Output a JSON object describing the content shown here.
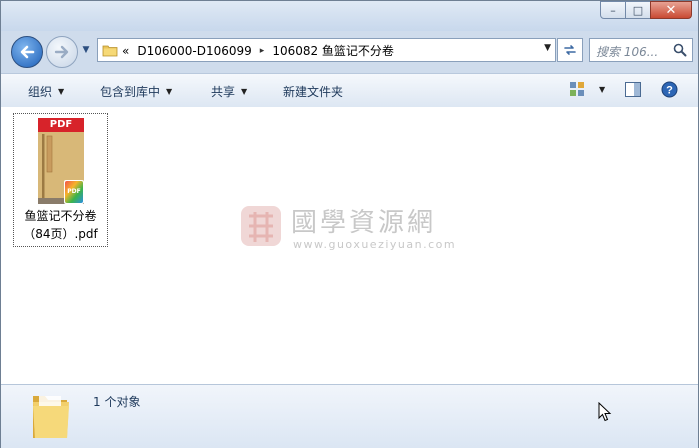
{
  "window": {
    "caption": {
      "minimize": "–",
      "maximize": "□",
      "close": "✕"
    }
  },
  "navigation": {
    "back_icon": "arrow-left-icon",
    "forward_icon": "arrow-right-icon",
    "recent_dropdown": "▼"
  },
  "address": {
    "overflow_chevron": "«",
    "crumbs": [
      "D106000-D106099",
      "106082 鱼篮记不分卷"
    ],
    "separator": "▸",
    "dropdown": "▼"
  },
  "search": {
    "placeholder": "搜索 106..."
  },
  "toolbar": {
    "organize": "组织",
    "include_in_library": "包含到库中",
    "share": "共享",
    "new_folder": "新建文件夹",
    "arrow": "▼"
  },
  "files": [
    {
      "name": "鱼篮记不分卷（84页）.pdf",
      "type": "pdf",
      "thumb_label": "PDF"
    }
  ],
  "watermark": {
    "title": "國學資源網",
    "url": "www.guoxueziyuan.com"
  },
  "details": {
    "count_text": "1 个对象"
  },
  "colors": {
    "accent": "#1c5fb8",
    "pdf_red": "#d7232a",
    "book_cover": "#d8b878"
  }
}
